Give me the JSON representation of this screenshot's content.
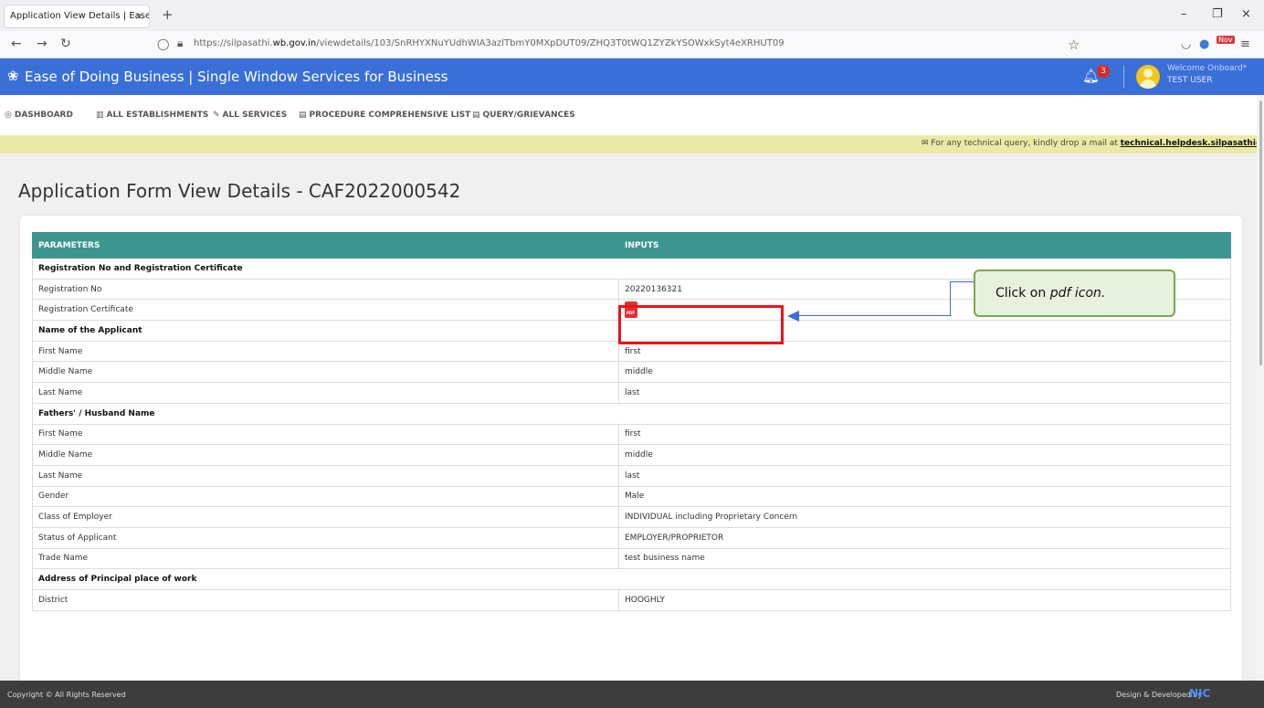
{
  "browser": {
    "tab_title": "Application View Details | Ease of do",
    "tab_close": "×",
    "new_tab": "+",
    "url_host": "https://silpasathi.wb.gov.in",
    "url_prefix": "https://silpasathi.",
    "url_domain": "wb.gov.in",
    "url_path": "/viewdetails/103/SnRHYXNuYUdhWIA3azlTbmY0MXpDUT09/ZHQ3T0tWQ1ZYZkYSOWxkSyt4eXRHUT09",
    "minimize": "–",
    "maximize": "❐",
    "close": "×",
    "ext_badge": "Nov"
  },
  "header": {
    "brand": "Ease of Doing Business | Single Window Services for Business",
    "notification_count": "3",
    "welcome": "Welcome Onboard*",
    "user": "TEST USER"
  },
  "menu": {
    "items": [
      "DASHBOARD",
      "ALL ESTABLISHMENTS",
      "ALL SERVICES",
      "PROCEDURE COMPREHENSIVE LIST",
      "QUERY/GRIEVANCES"
    ]
  },
  "notice": {
    "text": "For any technical query, kindly drop a mail at",
    "email": "technical.helpdesk.silpasathi@gmail.com"
  },
  "page": {
    "title": "Application Form View Details - CAF2022000542"
  },
  "table": {
    "headers": [
      "PARAMETERS",
      "INPUTS"
    ],
    "rows": [
      {
        "label": "Registration No and Registration Certificate",
        "value": "",
        "section": true
      },
      {
        "label": "Registration No",
        "value": "20220136321"
      },
      {
        "label": "Registration Certificate",
        "value": "",
        "pdf": true
      },
      {
        "label": "Name of the Applicant",
        "value": "",
        "section": true
      },
      {
        "label": "First Name",
        "value": "first"
      },
      {
        "label": "Middle Name",
        "value": "middle"
      },
      {
        "label": "Last Name",
        "value": "last"
      },
      {
        "label": "Fathers' / Husband Name",
        "value": "",
        "section": true
      },
      {
        "label": "First Name",
        "value": "first"
      },
      {
        "label": "Middle Name",
        "value": "middle"
      },
      {
        "label": "Last Name",
        "value": "last"
      },
      {
        "label": "Gender",
        "value": "Male"
      },
      {
        "label": "Class of Employer",
        "value": "INDIVIDUAL including Proprietary Concern"
      },
      {
        "label": "Status of Applicant",
        "value": "EMPLOYER/PROPRIETOR"
      },
      {
        "label": "Trade Name",
        "value": "test business name"
      },
      {
        "label": "Address of Principal place of work",
        "value": "",
        "section": true
      },
      {
        "label": "District",
        "value": "HOOGHLY"
      }
    ]
  },
  "pdf_label": "PDF",
  "callout": {
    "prefix": "Click on ",
    "emphasis": "pdf icon."
  },
  "footer": {
    "copyright": "Copyright © All Rights Reserved",
    "design": "Design & Developed by",
    "nic": "NIC"
  },
  "colors": {
    "header_blue": "#3a6fd8",
    "table_header": "#3c958f",
    "notice_bg": "#ebe9a6",
    "highlight_red": "#e8141c",
    "callout_border": "#77a84f"
  }
}
